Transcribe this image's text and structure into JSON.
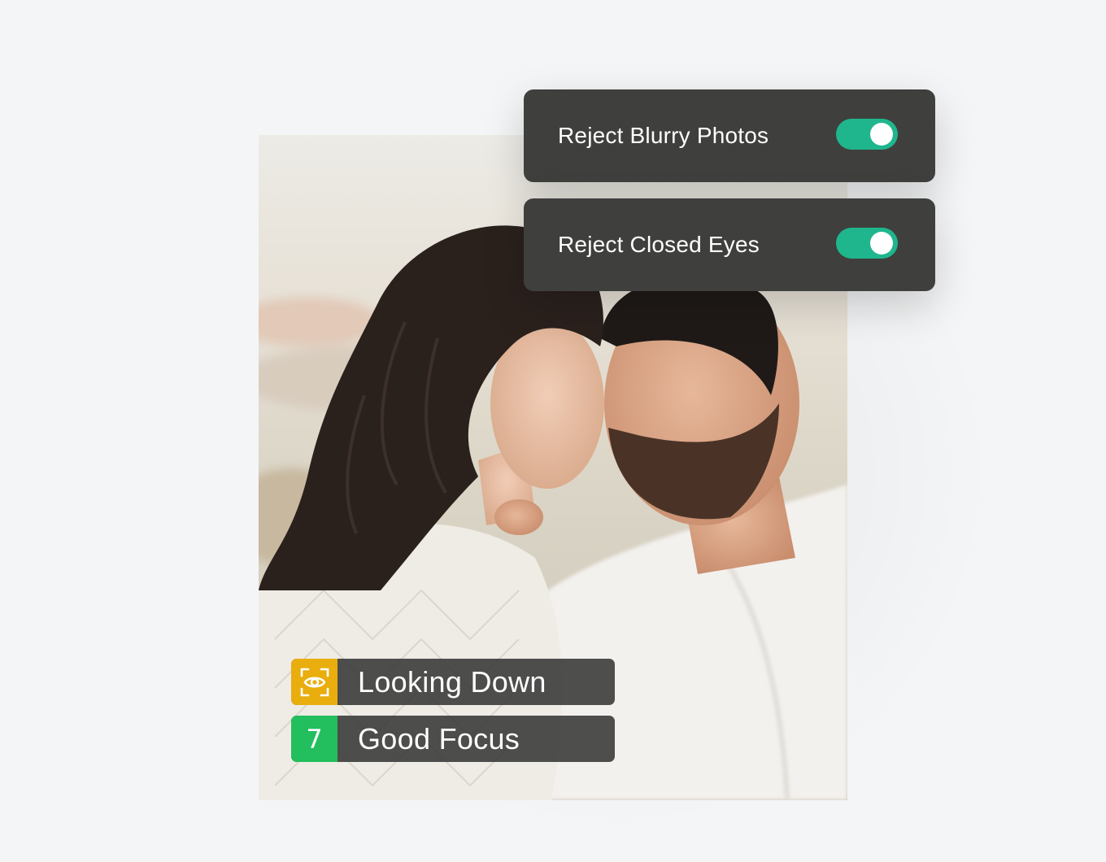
{
  "settings": [
    {
      "label": "Reject Blurry Photos",
      "enabled": true
    },
    {
      "label": "Reject Closed Eyes",
      "enabled": true
    }
  ],
  "tags": [
    {
      "icon": "eye-scan-icon",
      "label": "Looking Down",
      "color": "#e9ae0e"
    },
    {
      "badge": "7",
      "label": "Good Focus",
      "color": "#23be5d"
    }
  ],
  "colors": {
    "toggle_on": "#1fb68d",
    "panel_bg": "#3f3f3e"
  }
}
